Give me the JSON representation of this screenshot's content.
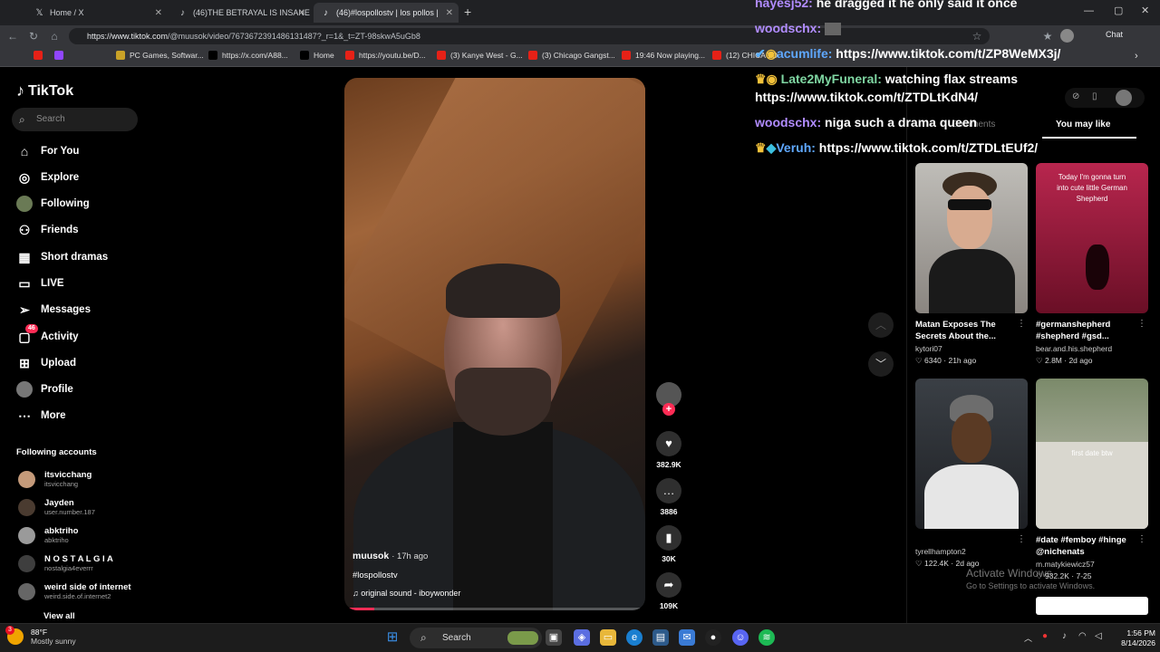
{
  "browser": {
    "tabs": [
      {
        "title": "Home / X"
      },
      {
        "title": "(46)THE BETRAYAL IS INSANE"
      },
      {
        "title": "(46)#lospollostv | los pollos |"
      }
    ],
    "url_host": "https://www.tiktok.com",
    "url_path": "/@muusok/video/7673672391486131487?_r=1&_t=ZT-98skwA5uGb8",
    "chat_label": "Chat",
    "bookmarks": [
      "PC Games, Softwar...",
      "https://x.com/A88...",
      "Home",
      "https://youtu.be/D...",
      "(3) Kanye West - G...",
      "(3) Chicago Gangst...",
      "19:46 Now playing...",
      "(12) CHICAGO"
    ]
  },
  "sidebar": {
    "logo": "TikTok",
    "search_placeholder": "Search",
    "nav": [
      {
        "label": "For You",
        "icon": "home-icon"
      },
      {
        "label": "Explore",
        "icon": "compass-icon"
      },
      {
        "label": "Following",
        "icon": "avatar-icon"
      },
      {
        "label": "Friends",
        "icon": "people-icon"
      },
      {
        "label": "Short dramas",
        "icon": "film-icon"
      },
      {
        "label": "LIVE",
        "icon": "live-icon"
      },
      {
        "label": "Messages",
        "icon": "send-icon"
      },
      {
        "label": "Activity",
        "icon": "inbox-icon",
        "badge": "46"
      },
      {
        "label": "Upload",
        "icon": "plus-square-icon"
      },
      {
        "label": "Profile",
        "icon": "avatar-icon"
      },
      {
        "label": "More",
        "icon": "more-icon"
      }
    ],
    "following_title": "Following accounts",
    "accounts": [
      {
        "name": "itsvicchang",
        "user": "itsvicchang"
      },
      {
        "name": "Jayden",
        "user": "user.number.187"
      },
      {
        "name": "abktriho",
        "user": "abktriho"
      },
      {
        "name": "N O S T A L G I A",
        "user": "nostalgia4everrr"
      },
      {
        "name": "weird side of internet",
        "user": "weird.side.of.internet2"
      }
    ],
    "view_all": "View all"
  },
  "video": {
    "user": "muusok",
    "ago": "· 17h ago",
    "tag": "#lospollostv",
    "sound": "original sound - iboywonder",
    "progress": 0.1
  },
  "actions": {
    "likes": "382.9K",
    "comments": "3886",
    "saves": "30K",
    "shares": "109K"
  },
  "chat": [
    {
      "name": "hayesj52:",
      "text": " he dragged it he only said it once"
    },
    {
      "name": "woodschx:",
      "text": ""
    },
    {
      "name": "acumlife:",
      "text": " https://www.tiktok.com/t/ZP8WeMX3j/"
    },
    {
      "name": "Late2MyFuneral:",
      "text": " watching flax streams"
    },
    {
      "name": "",
      "text": "https://www.tiktok.com/t/ZTDLtKdN4/"
    },
    {
      "name": "woodschx:",
      "text": " niga such a drama queen"
    },
    {
      "name": "Veruh:",
      "text": " https://www.tiktok.com/t/ZTDLtEUf2/"
    }
  ],
  "right_panel": {
    "tab_comments": "Comments",
    "tab_youmay": "You may like",
    "cards": [
      {
        "title": "Matan Exposes The Secrets About the...",
        "user": "kytori07",
        "likes": "6340",
        "ago": "21h ago",
        "overlay": ""
      },
      {
        "title": "#germanshepherd #shepherd #gsd...",
        "user": "bear.and.his.shepherd",
        "likes": "2.8M",
        "ago": "2d ago",
        "overlay": "Today I'm gonna turn into cute little German Shepherd"
      },
      {
        "title": "",
        "user": "tyrellhampton2",
        "likes": "122.4K",
        "ago": "2d ago",
        "overlay": ""
      },
      {
        "title": "#date #femboy #hinge @nichenats",
        "user": "m.matykiewicz57",
        "likes": "932.2K",
        "ago": "7-25",
        "overlay": "first date btw"
      }
    ]
  },
  "watermark": {
    "line1": "Activate Windows",
    "line2": "Go to Settings to activate Windows."
  },
  "taskbar": {
    "temp": "88°F",
    "weather": "Mostly sunny",
    "weather_badge": "3",
    "search": "Search",
    "time": "1:56 PM",
    "date": "8/14/2026"
  }
}
